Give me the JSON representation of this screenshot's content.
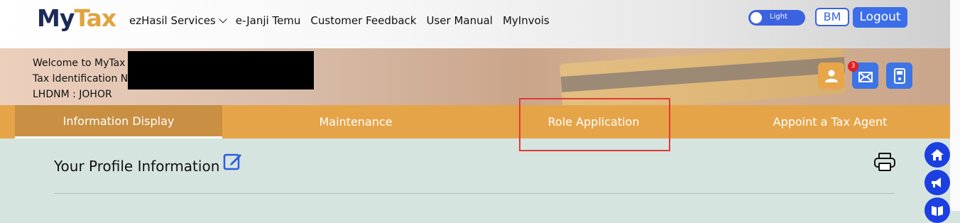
{
  "header": {
    "logo": {
      "part1": "My",
      "part2": "Tax"
    },
    "nav": [
      {
        "label": "ezHasil Services",
        "dropdown": true
      },
      {
        "label": "e-Janji Temu"
      },
      {
        "label": "Customer Feedback"
      },
      {
        "label": "User Manual"
      },
      {
        "label": "MyInvois"
      }
    ],
    "theme_toggle_label": "Light",
    "lang_button": "BM",
    "logout_button": "Logout"
  },
  "banner": {
    "welcome_line": "Welcome to MyTax",
    "tin_line": "Tax Identification N",
    "lhdnm_line": "LHDNM : JOHOR",
    "notification_count": "3",
    "icons": [
      "user-icon",
      "mail-icon",
      "tax-calculator-icon"
    ]
  },
  "tabs": [
    {
      "label": "Information Display",
      "active": true
    },
    {
      "label": "Maintenance"
    },
    {
      "label": "Role Application"
    },
    {
      "label": "Appoint a Tax Agent"
    }
  ],
  "profile": {
    "title": "Your Profile Information"
  },
  "colors": {
    "orange": "#e6a449",
    "blue": "#3d74e6",
    "highlight": "#e03a3a",
    "content_bg": "#d5e4de"
  }
}
